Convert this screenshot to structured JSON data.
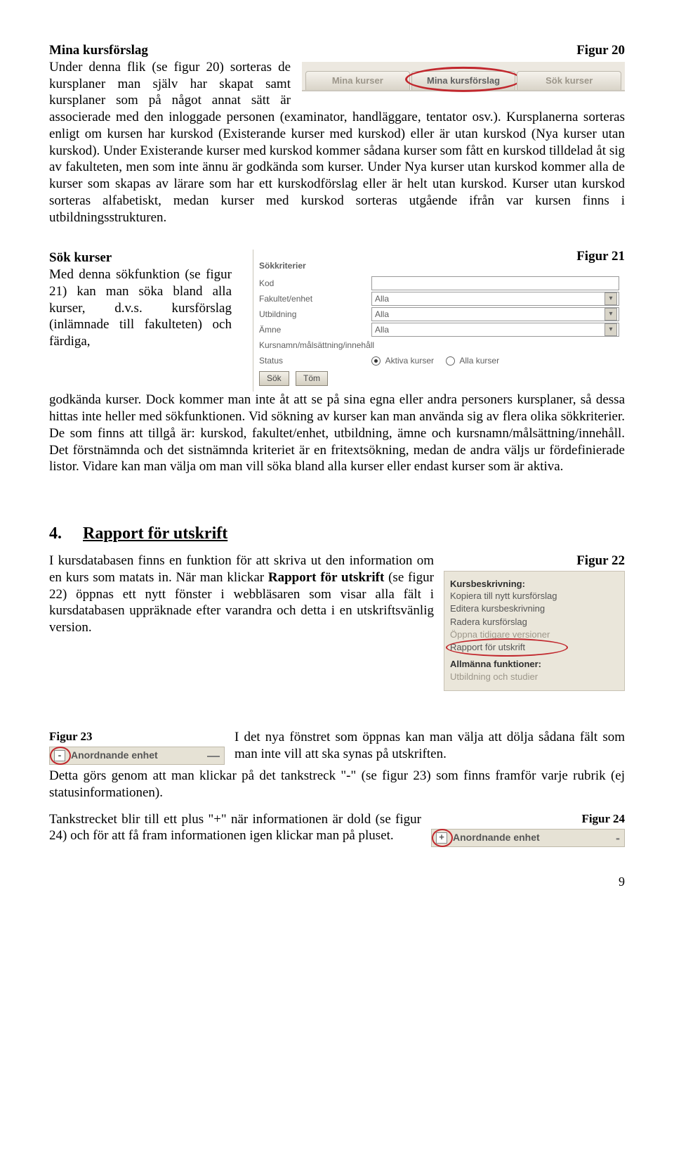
{
  "section1": {
    "title": "Mina kursförslag",
    "fig": "Figur 20",
    "tabs": [
      "Mina kurser",
      "Mina kursförslag",
      "Sök kurser"
    ],
    "body_lead": "Under denna flik (se figur 20) sorteras de kursplaner man själv har skapat samt kursplaner som på något annat sätt är associerade med den inloggade personen (examinator,",
    "body_rest": "handläggare, tentator osv.). Kursplanerna sorteras enligt om kursen har kurskod (Existerande kurser med kurskod) eller är utan kurskod (Nya kurser utan kurskod). Under Existerande kurser med kurskod kommer sådana kurser som fått en kurskod tilldelad åt sig av fakulteten, men som inte ännu är godkända som kurser. Under Nya kurser utan kurskod kommer alla de kurser som skapas av lärare som har ett kurskodförslag eller är helt utan kurskod. Kurser utan kurskod sorteras alfabetiskt, medan kurser med kurskod sorteras utgående ifrån var kursen finns i utbildningsstrukturen."
  },
  "section2": {
    "title": "Sök kurser",
    "fig": "Figur 21",
    "left_body": "Med denna sökfunktion (se figur 21) kan man söka bland alla kurser, d.v.s. kursförslag (inlämnade till fakul­teten) och färdiga,",
    "full_body": "godkända kurser. Dock kommer man inte åt att se på sina egna eller andra personers kursplaner, så dessa hittas inte heller med sökfunktionen. Vid sökning av kurser kan man använda sig av flera olika sökkriterier. De som finns att tillgå är: kurskod, fakultet/enhet, utbildning, ämne och kursnamn/målsättning/innehåll. Det förstnämnda och det sistnämnda kriteriet är en fritextsökning, medan de andra väljs ur fördefinierade listor. Vidare kan man välja om man vill söka bland alla kurser eller endast kurser som är aktiva.",
    "form": {
      "heading": "Sökkriterier",
      "rows": {
        "kod": "Kod",
        "fak": "Fakultet/enhet",
        "utb": "Utbildning",
        "amne": "Ämne",
        "namn": "Kursnamn/målsättning/innehåll",
        "status": "Status"
      },
      "select_value": "Alla",
      "radio1": "Aktiva kurser",
      "radio2": "Alla kurser",
      "btn_search": "Sök",
      "btn_clear": "Töm"
    }
  },
  "section3": {
    "num": "4.",
    "title": "Rapport för utskrift",
    "fig": "Figur 22",
    "body_p1a": "I kursdatabasen finns en funktion för att skriva ut den information om en kurs som matats in. När man klickar ",
    "body_p1b": "Rapport för utskrift",
    "body_p1c": " (se figur 22) öppnas ett nytt fönster i webbläsaren som visar alla fält i kursdatabasen uppräknade efter varandra och detta i en utskriftsvänlig version.",
    "menu": {
      "hd1": "Kursbeskrivning:",
      "i1": "Kopiera till nytt kursförslag",
      "i2": "Editera kursbeskrivning",
      "i3": "Radera kursförslag",
      "i4": "Öppna tidigare versioner",
      "i5": "Rapport för utskrift",
      "hd2": "Allmänna funktioner:",
      "i6": "Utbildning och studier"
    }
  },
  "section4": {
    "fig23": "Figur 23",
    "bar23_label": "Anordnande enhet",
    "bar23_symbol": "-",
    "bar23_trail": "—",
    "p1_lead": "I det nya fönstret som öppnas kan man välja att dölja sådana fält som man inte vill att ska synas på utskriften.",
    "p1_rest": "Detta görs genom att man klickar på det tankstreck \"-\" (se figur 23) som finns framför varje rubrik (ej statusinformationen).",
    "fig24": "Figur 24",
    "bar24_label": "Anordnande enhet",
    "bar24_symbol": "+",
    "bar24_trail": "-",
    "p2": "Tankstrecket blir till ett plus \"+\" när informationen är dold (se figur 24) och för att få fram informationen igen klickar man på pluset."
  },
  "page_number": "9"
}
